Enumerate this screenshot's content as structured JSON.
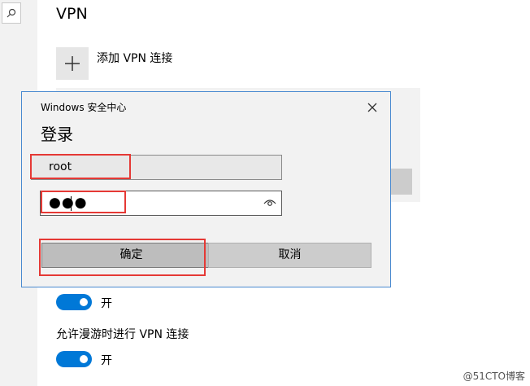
{
  "page": {
    "title": "VPN",
    "add_vpn_label": "添加 VPN 连接",
    "toggle1_label": "开",
    "roaming_label": "允许漫游时进行 VPN 连接",
    "toggle2_label": "开"
  },
  "dialog": {
    "title": "Windows 安全中心",
    "heading": "登录",
    "username": "root",
    "password_mask": "●●●",
    "ok_label": "确定",
    "cancel_label": "取消"
  },
  "toggles": {
    "metered_on": true,
    "roaming_on": true
  },
  "colors": {
    "accent": "#0078d7",
    "highlight": "#e53935",
    "dialog_border": "#4a8ad0"
  },
  "icons": {
    "search": "search-icon",
    "add": "plus-icon",
    "close": "close-icon",
    "reveal": "eye-icon"
  },
  "watermark": "@51CTO博客"
}
